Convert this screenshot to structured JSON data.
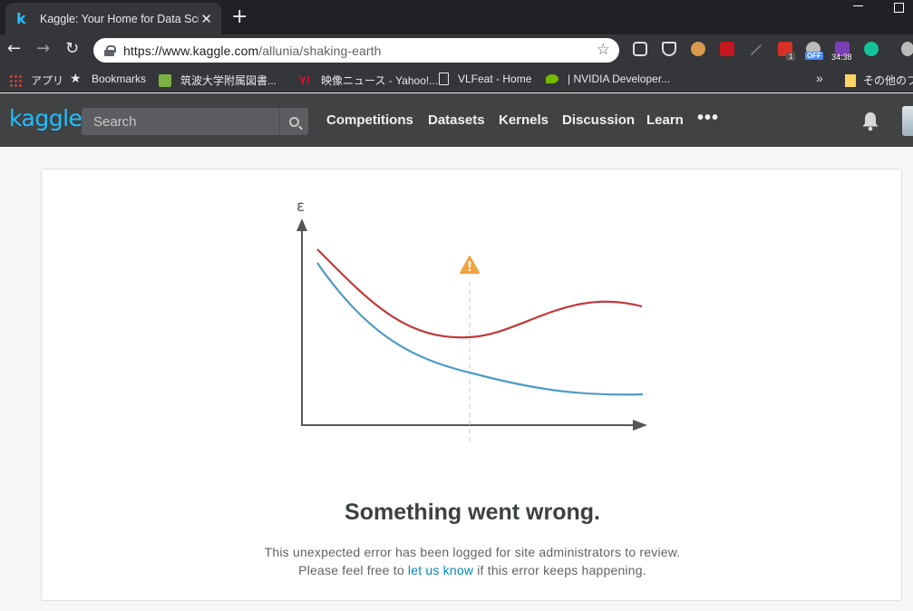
{
  "browser": {
    "tab_title": "Kaggle: Your Home for Data Science",
    "tab_favicon": "k",
    "url_host": "https://www.kaggle.com",
    "url_path": "/allunia/shaking-earth",
    "extensions": {
      "badge_count": "1",
      "off_label": "OFF",
      "timer": "34:38"
    },
    "bookmarks": [
      {
        "label": "アプリ",
        "icon": "apps-grid-icon"
      },
      {
        "label": "Bookmarks",
        "icon": "star-icon"
      },
      {
        "label": "筑波大学附属図書...",
        "icon": "library-icon"
      },
      {
        "label": "映像ニュース - Yahoo!...",
        "icon": "yahoo-icon"
      },
      {
        "label": "VLFeat - Home",
        "icon": "page-icon"
      },
      {
        "label": "| NVIDIA Developer...",
        "icon": "nvidia-icon"
      }
    ],
    "bookmarks_overflow": "»",
    "other_bookmarks": "その他のブ"
  },
  "kaggle": {
    "logo": "kaggle",
    "search_placeholder": "Search",
    "nav": [
      "Competitions",
      "Datasets",
      "Kernels",
      "Discussion",
      "Learn"
    ],
    "more": "•••"
  },
  "error": {
    "axis_label": "ε",
    "title": "Something went wrong.",
    "line1": "This unexpected error has been logged for site administrators to review.",
    "line2_before": "Please feel free to",
    "line2_link": "let us know",
    "line2_after": "if this error keeps happening."
  },
  "colors": {
    "kaggle_blue": "#20beff",
    "header_bg": "#404244",
    "curve_red": "#c0393b",
    "curve_blue": "#4d9bc4",
    "warning": "#f0a340",
    "link": "#008abc"
  }
}
